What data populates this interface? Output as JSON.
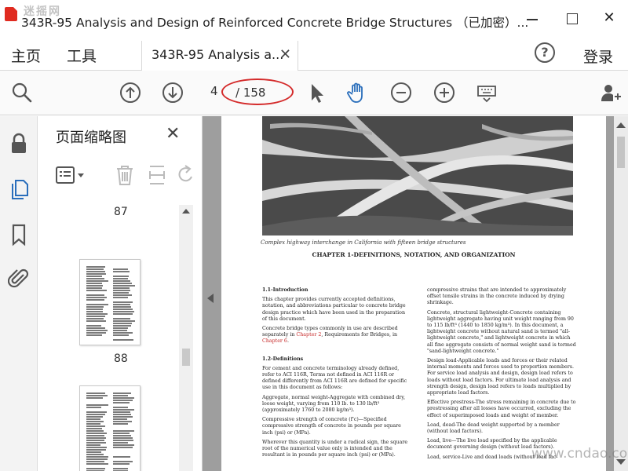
{
  "window": {
    "title": "343R-95 Analysis and Design of Reinforced Concrete Bridge Structures （已加密）...",
    "watermark_top": "迷摇网",
    "minimize_label": "—",
    "close_label": "✕"
  },
  "menu": {
    "home": "主页",
    "tools": "工具",
    "tab_label": "343R-95 Analysis a...",
    "tab_close": "✕",
    "help": "?",
    "login": "登录"
  },
  "toolbar": {
    "page_current": "4",
    "page_total": "/ 158",
    "highlight_color": "#d42b2b"
  },
  "thumbnails": {
    "panel_title": "页面缩略图",
    "close": "✕",
    "pages": [
      {
        "number": "87"
      },
      {
        "number": "88"
      }
    ]
  },
  "document": {
    "caption": "Complex highway interchange in California with fifteen bridge structures",
    "chapter_title": "CHAPTER 1-DEFINITIONS, NOTATION, AND ORGANIZATION",
    "col1": {
      "h1": "1.1-Introduction",
      "p1": "This chapter provides currently accepted definitions, notation, and abbreviations particular to concrete bridge design practice which have been used in the preparation of this document.",
      "p2a": "Concrete bridge types commonly in use are described separately in ",
      "p2link1": "Chapter 2",
      "p2b": ", Requirements for Bridges, in ",
      "p2link2": "Chapter 6",
      "p2c": ".",
      "h2": "1.2-Definitions",
      "p3": "For cement and concrete terminology already defined, refer to ACI 116R, Terms not defined in ACI 116R or defined differently from ACI 116R are defined for specific use in this document as follows:",
      "p4": "Aggregate, normal weight-Aggregate with combined dry, loose weight, varying from 110 lb. to 130 lb/ft³ (approximately 1760 to 2080 kg/m³).",
      "p5": "Compressive strength of concrete (f'c)—Specified compressive strength of concrete in pounds per square inch (psi) or (MPa).",
      "p6": "Wherever this quantity is under a radical sign, the square root of the numerical value only is intended and the resultant is in pounds per square inch (psi) or (MPa)."
    },
    "col2": {
      "p1": "compressive strains that are intended to approximately offset tensile strains in the concrete induced by drying shrinkage.",
      "p2": "Concrete, structural lightweight-Concrete containing lightweight aggregate having unit weight ranging from 90 to 115 lb/ft³ (1440 to 1850 kg/m³). In this document, a lightweight concrete without natural sand is termed \"all-lightweight concrete,\" and lightweight concrete in which all fine aggregate consists of normal weight sand is termed \"sand-lightweight concrete.\"",
      "p3": "Design load-Applicable loads and forces or their related internal moments and forces used to proportion members. For service load analysis and design, design load refers to loads without load factors. For ultimate load analysis and strength design, design load refers to loads multiplied by appropriate load factors.",
      "p4": "Effective prestress-The stress remaining in concrete due to prestressing after all losses have occurred, excluding the effect of superimposed loads and weight of member.",
      "p5": "Load, dead-The dead weight supported by a member (without load factors).",
      "p6": "Load, live—The live load specified by the applicable document governing design (without load factors).",
      "p7": "Load, service-Live and dead loads (without load fac-"
    }
  },
  "watermark_bottom": "www.cndao.com"
}
